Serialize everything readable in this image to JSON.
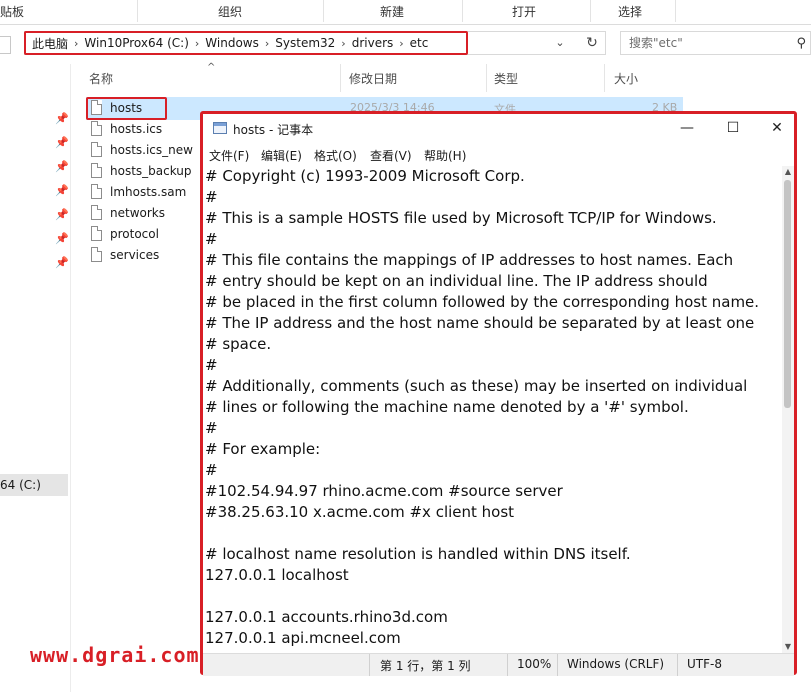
{
  "ribbon": {
    "tabs": [
      "贴板",
      "组织",
      "新建",
      "打开",
      "选择"
    ]
  },
  "address": {
    "crumbs": [
      "此电脑",
      "Win10Prox64 (C:)",
      "Windows",
      "System32",
      "drivers",
      "etc"
    ],
    "search_placeholder": "搜索\"etc\""
  },
  "nav": {
    "drive_label": "64 (C:)"
  },
  "columns": {
    "name": "名称",
    "modified": "修改日期",
    "type": "类型",
    "size": "大小"
  },
  "files": [
    {
      "name": "hosts",
      "modified": "2025/3/3 14:46",
      "type": "文件",
      "size": "2 KB"
    },
    {
      "name": "hosts.ics"
    },
    {
      "name": "hosts.ics_new"
    },
    {
      "name": "hosts_backup"
    },
    {
      "name": "lmhosts.sam"
    },
    {
      "name": "networks"
    },
    {
      "name": "protocol"
    },
    {
      "name": "services"
    }
  ],
  "notepad": {
    "title": "hosts - 记事本",
    "menus": [
      "文件(F)",
      "编辑(E)",
      "格式(O)",
      "查看(V)",
      "帮助(H)"
    ],
    "lines": [
      "# Copyright (c) 1993-2009 Microsoft Corp.",
      "#",
      "# This is a sample HOSTS file used by Microsoft TCP/IP for Windows.",
      "#",
      "# This file contains the mappings of IP addresses to host names. Each",
      "# entry should be kept on an individual line. The IP address should",
      "# be placed in the first column followed by the corresponding host name.",
      "# The IP address and the host name should be separated by at least one",
      "# space.",
      "#",
      "# Additionally, comments (such as these) may be inserted on individual",
      "# lines or following the machine name denoted by a '#' symbol.",
      "#",
      "# For example:",
      "#",
      "#102.54.94.97 rhino.acme.com #source server",
      "#38.25.63.10 x.acme.com #x client host",
      "",
      "# localhost name resolution is handled within DNS itself.",
      "127.0.0.1 localhost",
      "",
      "127.0.0.1 accounts.rhino3d.com",
      "127.0.0.1 api.mcneel.com"
    ],
    "status": {
      "position": "第 1 行，第 1 列",
      "zoom": "100%",
      "line_ending": "Windows (CRLF)",
      "encoding": "UTF-8"
    }
  },
  "watermark": "www.dgrai.com",
  "colors": {
    "highlight_red": "#d81f26",
    "selection_blue": "#cce8ff"
  }
}
